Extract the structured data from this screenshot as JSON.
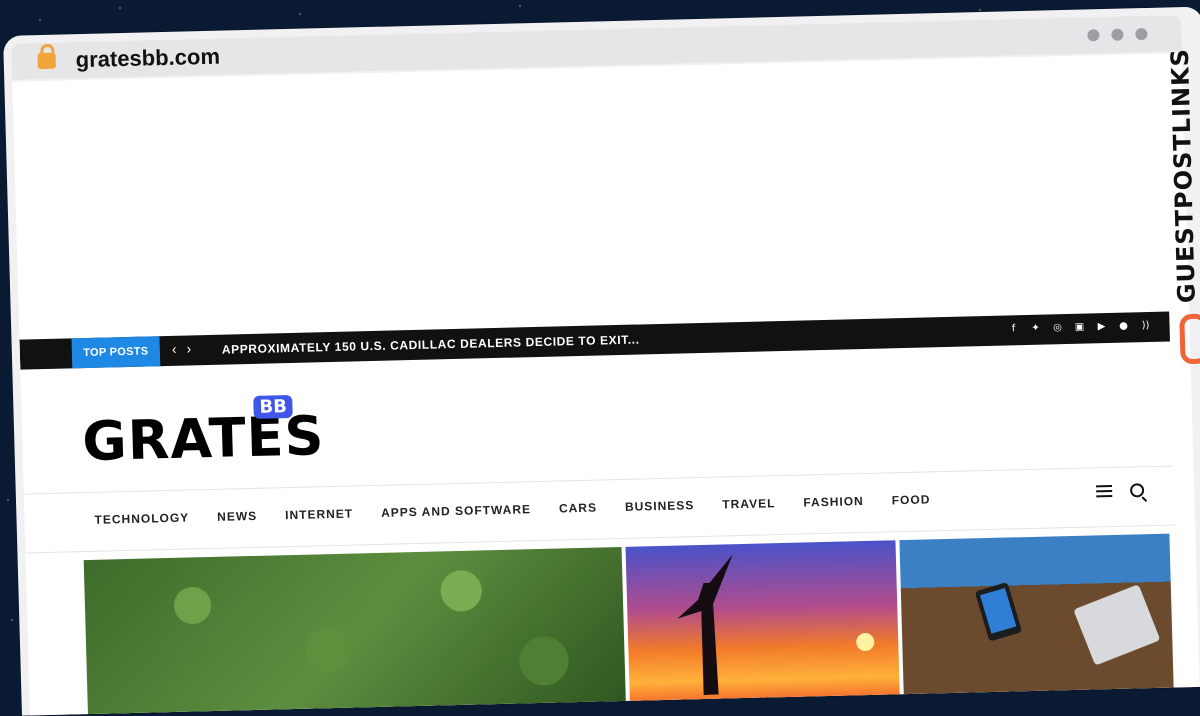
{
  "browser": {
    "url": "gratesbb.com"
  },
  "topbar": {
    "label": "TOP POSTS",
    "prev": "‹",
    "next": "›",
    "ticker": "APPROXIMATELY 150 U.S. CADILLAC DEALERS DECIDE TO EXIT...",
    "social_icons": [
      "facebook-icon",
      "twitter-icon",
      "instagram-icon",
      "linkedin-icon",
      "youtube-icon",
      "snapchat-icon",
      "rss-icon"
    ]
  },
  "logo": {
    "text": "GRATES",
    "badge": "BB"
  },
  "nav": {
    "items": [
      "TECHNOLOGY",
      "NEWS",
      "INTERNET",
      "APPS AND SOFTWARE",
      "CARS",
      "BUSINESS",
      "TRAVEL",
      "FASHION",
      "FOOD"
    ]
  },
  "brand": {
    "text": "GUESTPOSTLINKS"
  },
  "colors": {
    "accent": "#1e88e5",
    "badge": "#3e57e8",
    "brand": "#f0643a"
  }
}
